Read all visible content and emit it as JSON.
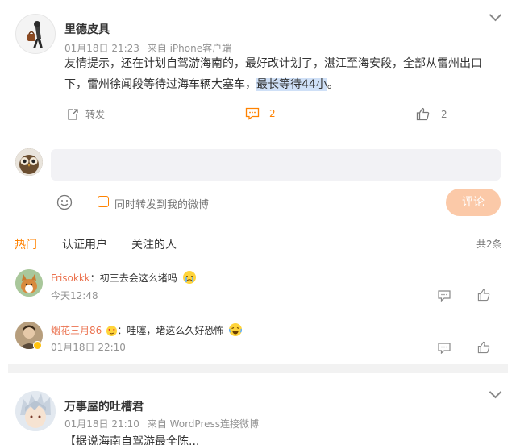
{
  "post": {
    "author": "里德皮具",
    "date": "01月18日 21:23",
    "source": "来自 iPhone客户端",
    "text_before": "友情提示，还在计划自驾游海南的，最好改计划了，湛江至海安段，全部从雷州出口下，雷州徐闻段等待过海车辆大塞车，",
    "text_highlight": "最长等待44小",
    "text_after": "。",
    "repost_label": "转发",
    "comment_count": "2",
    "like_count": "2"
  },
  "composer": {
    "placeholder": "",
    "sync_label": "同时转发到我的微博",
    "submit_label": "评论"
  },
  "tabs": {
    "items": [
      "热门",
      "认证用户",
      "关注的人"
    ],
    "total": "共2条"
  },
  "comments": [
    {
      "name": "Frisokkk",
      "text": "：初三去会这么堵吗",
      "time": "今天12:48"
    },
    {
      "name": "烟花三月86",
      "text": "：哇噻，堵这么久好恐怖",
      "time": "01月18日 22:10"
    }
  ],
  "post2": {
    "author": "万事屋的吐槽君",
    "date": "01月18日 21:10",
    "source": "来自 WordPress连接微博",
    "text_partial": "【据说海南自驾游最全陈..."
  },
  "colors": {
    "accent": "#ff8200",
    "comment_name": "#eb7350",
    "highlight": "#cfe0f7"
  },
  "icons": [
    "chevron-down-icon",
    "repost-icon",
    "comment-icon",
    "like-icon",
    "emoji-icon",
    "checkbox-icon",
    "reply-icon",
    "thumb-icon"
  ]
}
